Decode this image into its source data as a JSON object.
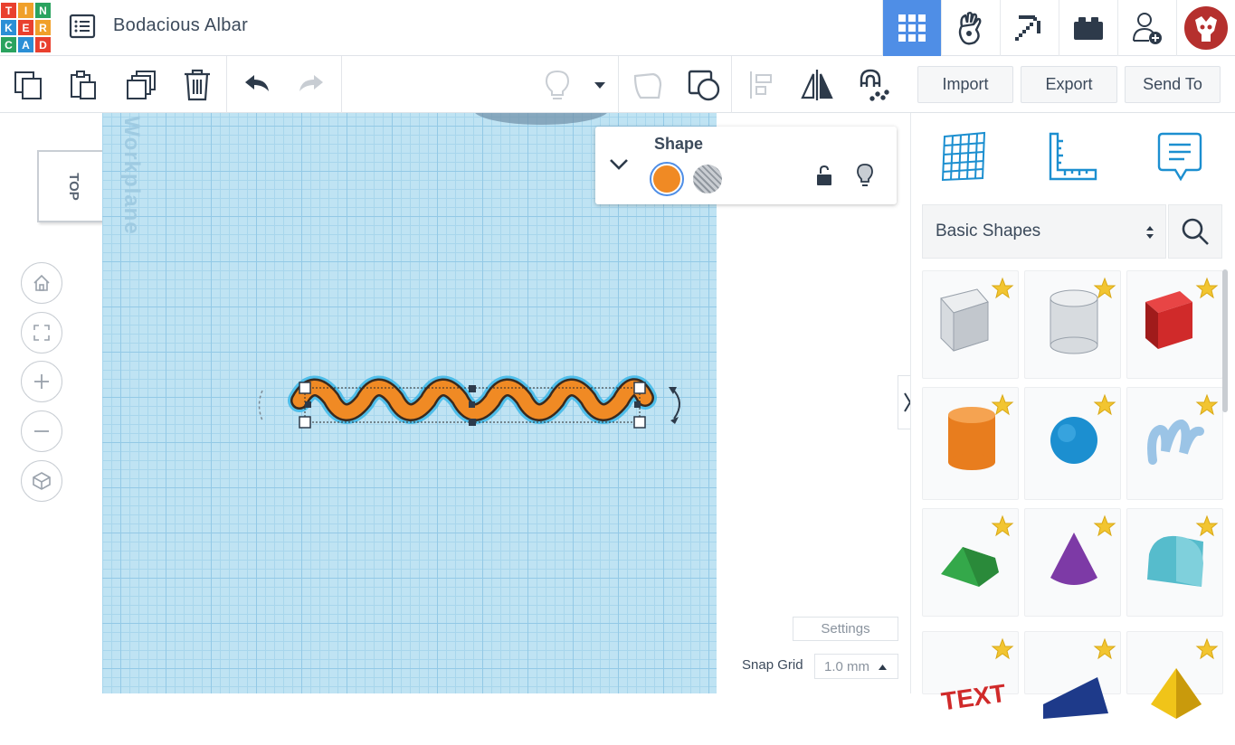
{
  "logo": {
    "letters": [
      "T",
      "I",
      "N",
      "K",
      "E",
      "R",
      "C",
      "A",
      "D"
    ],
    "colors": [
      "#e9402e",
      "#f0a02a",
      "#2aa35f",
      "#2b8fd6",
      "#e9402e",
      "#f0a02a",
      "#2aa35f",
      "#2b8fd6",
      "#e9402e"
    ]
  },
  "header": {
    "title": "Bodacious Albar",
    "icons": [
      "3d-design-grid-icon",
      "codeblocks-icon",
      "minecraft-pickaxe-icon",
      "lego-brick-icon",
      "add-user-icon",
      "profile-avatar-icon"
    ]
  },
  "toolbar": {
    "icons": [
      "copy-icon",
      "paste-icon",
      "duplicate-icon",
      "delete-icon",
      "undo-icon",
      "redo-icon",
      "show-hidden-icon",
      "dropdown-icon",
      "group-icon",
      "ungroup-icon",
      "align-icon",
      "mirror-icon",
      "magnet-icon"
    ],
    "import_label": "Import",
    "export_label": "Export",
    "sendto_label": "Send To"
  },
  "viewcube": {
    "label": "TOP"
  },
  "nav": {
    "icons": [
      "home-view-icon",
      "fit-all-icon",
      "zoom-in-icon",
      "zoom-out-icon",
      "perspective-icon"
    ]
  },
  "workplane": {
    "watermark": "Workplane",
    "grid_color": "#bfe3f3",
    "shape_color": "#f08a24"
  },
  "shape_panel": {
    "title": "Shape",
    "solid_color": "#f08a24"
  },
  "bottom": {
    "settings_label": "Settings",
    "snap_label": "Snap Grid",
    "snap_value": "1.0 mm"
  },
  "library": {
    "tabs": [
      "workplane-grid-icon",
      "ruler-icon",
      "notes-icon"
    ],
    "selected_category": "Basic Shapes",
    "shapes": [
      {
        "name": "box-hole",
        "color": "#c8cdd2"
      },
      {
        "name": "cylinder-hole",
        "color": "#c8cdd2"
      },
      {
        "name": "box",
        "color": "#d02a2a"
      },
      {
        "name": "cylinder",
        "color": "#e87d1e"
      },
      {
        "name": "sphere",
        "color": "#1c8fd0"
      },
      {
        "name": "scribble",
        "color": "#9bc4e6"
      },
      {
        "name": "roof",
        "color": "#34a84a"
      },
      {
        "name": "cone",
        "color": "#7d3aa6"
      },
      {
        "name": "round-roof",
        "color": "#56bccc"
      },
      {
        "name": "text",
        "color": "#d02a2a"
      },
      {
        "name": "wedge",
        "color": "#1e3a8a"
      },
      {
        "name": "pyramid",
        "color": "#f0c419"
      }
    ]
  }
}
